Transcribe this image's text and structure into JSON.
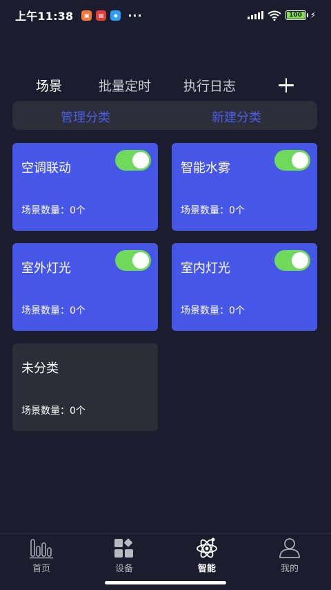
{
  "status_bar": {
    "time": "上午11:38",
    "app_icons": [
      "orange-app-icon",
      "red-app-icon",
      "blue-app-icon"
    ],
    "more": "···",
    "battery": "100"
  },
  "top_tabs": [
    {
      "label": "场景",
      "active": true
    },
    {
      "label": "批量定时",
      "active": false
    },
    {
      "label": "执行日志",
      "active": false
    }
  ],
  "manage_bar": {
    "manage_label": "管理分类",
    "new_label": "新建分类"
  },
  "cards": [
    {
      "title": "空调联动",
      "count": "场景数量：0个",
      "toggle_on": true
    },
    {
      "title": "智能水雾",
      "count": "场景数量：0个",
      "toggle_on": true
    },
    {
      "title": "室外灯光",
      "count": "场景数量：0个",
      "toggle_on": true
    },
    {
      "title": "室内灯光",
      "count": "场景数量：0个",
      "toggle_on": true
    },
    {
      "title": "未分类",
      "count": "场景数量：0个",
      "toggle_on": false
    }
  ],
  "bottom_nav": [
    {
      "label": "首页",
      "icon": "bar-chart-icon",
      "active": false
    },
    {
      "label": "设备",
      "icon": "devices-icon",
      "active": false
    },
    {
      "label": "智能",
      "icon": "atom-icon",
      "active": true
    },
    {
      "label": "我的",
      "icon": "user-icon",
      "active": false
    }
  ],
  "colors": {
    "background": "#1b1d2e",
    "card_blue": "#4657e8",
    "card_gray": "#2c2d37",
    "accent_link": "#4a5de6",
    "toggle_green": "#6ed95a"
  }
}
